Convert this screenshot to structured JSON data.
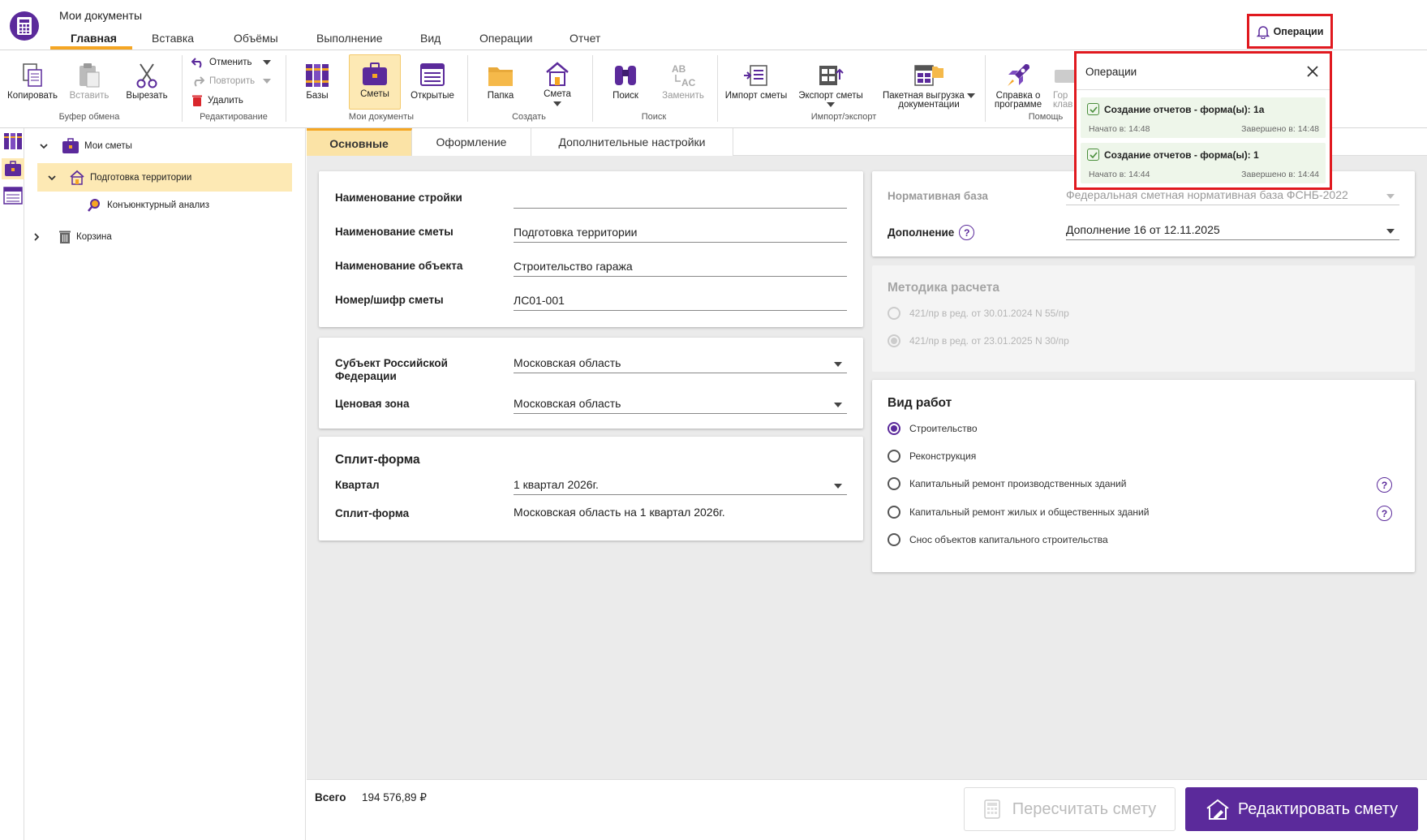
{
  "app": {
    "title": "Мои документы",
    "accent": "#5b2a9b",
    "highlight": "#f5a623"
  },
  "menu": {
    "tabs": [
      "Главная",
      "Вставка",
      "Объёмы",
      "Выполнение",
      "Вид",
      "Операции",
      "Отчет"
    ],
    "active": 0
  },
  "ribbon": {
    "clipboard": {
      "copy": "Копировать",
      "paste": "Вставить",
      "cut": "Вырезать",
      "group": "Буфер обмена"
    },
    "editing": {
      "undo": "Отменить",
      "redo": "Повторить",
      "delete": "Удалить",
      "group": "Редактирование"
    },
    "mydocs": {
      "bases": "Базы",
      "estimates": "Сметы",
      "open": "Открытые",
      "group": "Мои документы"
    },
    "create": {
      "folder": "Папка",
      "estimate": "Смета",
      "group": "Создать"
    },
    "search": {
      "find": "Поиск",
      "replace": "Заменить",
      "group": "Поиск"
    },
    "importexport": {
      "import": "Импорт сметы",
      "export": "Экспорт сметы",
      "batch_line1": "Пакетная выгрузка",
      "batch_line2": "документации",
      "group": "Импорт/экспорт"
    },
    "help": {
      "about_line1": "Справка о",
      "about_line2": "программе",
      "hotkeys_line1": "Гор",
      "hotkeys_line2": "клав",
      "group": "Помощь"
    }
  },
  "tree": {
    "root": "Мои сметы",
    "selected": "Подготовка территории",
    "child": "Конъюнктурный анализ",
    "trash": "Корзина"
  },
  "content_tabs": [
    "Основные",
    "Оформление",
    "Дополнительные настройки"
  ],
  "general": {
    "construction_label": "Наименование стройки",
    "construction_value": "",
    "estimate_label": "Наименование сметы",
    "estimate_value": "Подготовка территории",
    "object_label": "Наименование объекта",
    "object_value": "Строительство гаража",
    "code_label": "Номер/шифр сметы",
    "code_value": "ЛС01-001"
  },
  "region": {
    "subject_label_line1": "Субъект Российской",
    "subject_label_line2": "Федерации",
    "subject_value": "Московская область",
    "zone_label": "Ценовая зона",
    "zone_value": "Московская область"
  },
  "split": {
    "title": "Сплит-форма",
    "quarter_label": "Квартал",
    "quarter_value": "1 квартал 2026г.",
    "split_label": "Сплит-форма",
    "split_value": "Московская область на 1 квартал 2026г."
  },
  "norm": {
    "base_label": "Нормативная база",
    "base_value": "Федеральная сметная нормативная база ФСНБ-2022",
    "supplement_label": "Дополнение",
    "supplement_value": "Дополнение 16 от 12.11.2025"
  },
  "method": {
    "title": "Методика расчета",
    "options": [
      "421/пр в ред. от 30.01.2024 N 55/пр",
      "421/пр в ред. от 23.01.2025 N 30/пр"
    ],
    "selected": 1
  },
  "work_type": {
    "title": "Вид работ",
    "options": [
      "Строительство",
      "Реконструкция",
      "Капитальный ремонт производственных зданий",
      "Капитальный ремонт жилых и общественных зданий",
      "Снос объектов капитального строительства"
    ],
    "selected": 0
  },
  "footer": {
    "total_label": "Всего",
    "total_value": "194 576,89 ₽",
    "recalc": "Пересчитать смету",
    "edit": "Редактировать смету"
  },
  "operations": {
    "button": "Операции",
    "panel_title": "Операции",
    "items": [
      {
        "title": "Создание отчетов - форма(ы): 1а",
        "started": "Начато в: 14:48",
        "finished": "Завершено в: 14:48"
      },
      {
        "title": "Создание отчетов - форма(ы): 1",
        "started": "Начато в: 14:44",
        "finished": "Завершено в: 14:44"
      }
    ]
  }
}
